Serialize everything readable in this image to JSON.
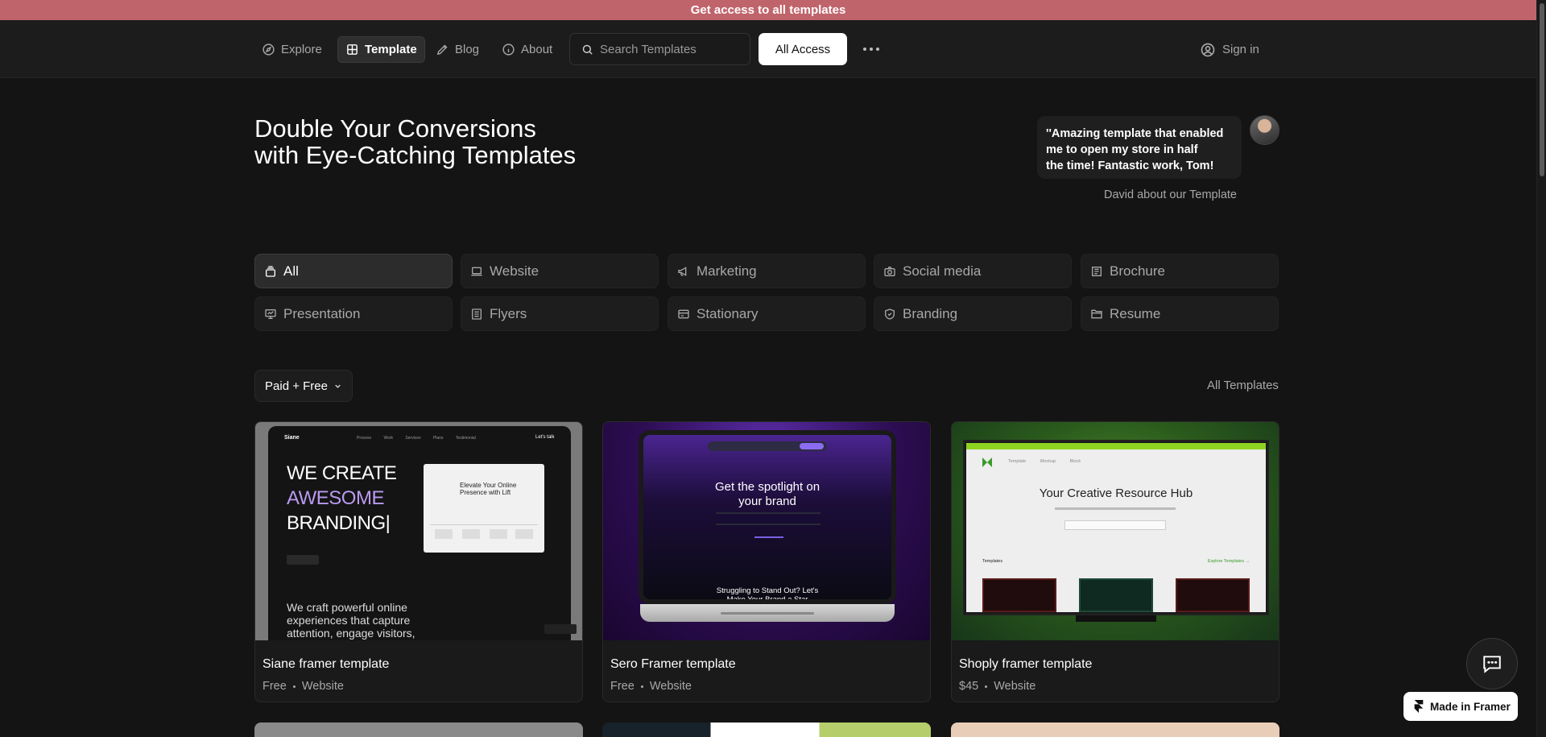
{
  "banner": {
    "text": "Get access to all templates"
  },
  "nav": {
    "items": [
      {
        "label": "Explore",
        "icon": "compass-icon",
        "active": false
      },
      {
        "label": "Template",
        "icon": "grid-icon",
        "active": true
      },
      {
        "label": "Blog",
        "icon": "pen-icon",
        "active": false
      },
      {
        "label": "About",
        "icon": "info-icon",
        "active": false
      }
    ],
    "search_placeholder": "Search Templates",
    "all_access_label": "All Access",
    "signin_label": "Sign in"
  },
  "hero": {
    "line1": "Double Your Conversions",
    "line2": "with Eye-Catching Templates",
    "quote_line1": "''Amazing template that enabled",
    "quote_line2": "me to open my store in half",
    "quote_line3": "the time! Fantastic work, Tom!",
    "quote_author": "David about our Template"
  },
  "categories": [
    {
      "label": "All",
      "icon": "stack-icon",
      "active": true
    },
    {
      "label": "Website",
      "icon": "laptop-icon",
      "active": false
    },
    {
      "label": "Marketing",
      "icon": "megaphone-icon",
      "active": false
    },
    {
      "label": "Social media",
      "icon": "camera-icon",
      "active": false
    },
    {
      "label": "Brochure",
      "icon": "brochure-icon",
      "active": false
    },
    {
      "label": "Presentation",
      "icon": "presentation-icon",
      "active": false
    },
    {
      "label": "Flyers",
      "icon": "flyer-icon",
      "active": false
    },
    {
      "label": "Stationary",
      "icon": "card-icon",
      "active": false
    },
    {
      "label": "Branding",
      "icon": "shield-icon",
      "active": false
    },
    {
      "label": "Resume",
      "icon": "folder-icon",
      "active": false
    }
  ],
  "filter": {
    "label": "Paid + Free",
    "all_templates_label": "All Templates"
  },
  "cards": [
    {
      "name": "Siane framer template",
      "price": "Free",
      "type": "Website",
      "preview": {
        "logo": "Siane",
        "links": "Process Work Services Plans Testimonial",
        "cta": "Let's talk",
        "line1": "WE CREATE",
        "line2": "AWESOME",
        "line3": "BRANDING|",
        "panel_title": "Elevate Your Online Presence with Lift",
        "para": "We craft powerful online experiences that capture attention, engage visitors,"
      }
    },
    {
      "name": "Sero Framer template",
      "price": "Free",
      "type": "Website",
      "preview": {
        "title": "Get the spotlight on your brand",
        "subtitle": "Struggling to Stand Out? Let's Make Your Brand a Star"
      }
    },
    {
      "name": "Shoply framer template",
      "price": "$45",
      "type": "Website",
      "preview": {
        "links": "Template Mockup Block",
        "title": "Your Creative Resource Hub",
        "section": "Templates",
        "explore": "Explore Templates →"
      }
    }
  ],
  "footer": {
    "made_in_framer": "Made in Framer"
  },
  "colors": {
    "banner": "#c0646b",
    "background": "#141414",
    "accent_purple": "#b99af0",
    "accent_green": "#8ed321"
  }
}
